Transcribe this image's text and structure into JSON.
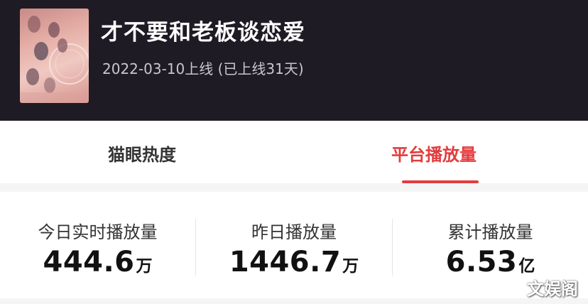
{
  "header": {
    "title": "才不要和老板谈恋爱",
    "release_info": "2022-03-10上线 (已上线31天)"
  },
  "tabs": [
    {
      "label": "猫眼热度",
      "active": false
    },
    {
      "label": "平台播放量",
      "active": true
    }
  ],
  "stats": [
    {
      "label": "今日实时播放量",
      "value": "444.6",
      "unit": "万"
    },
    {
      "label": "昨日播放量",
      "value": "1446.7",
      "unit": "万"
    },
    {
      "label": "累计播放量",
      "value": "6.53",
      "unit": "亿"
    }
  ],
  "watermark": "文娱阁",
  "colors": {
    "header_bg": "#1f1b24",
    "accent": "#e43b3d",
    "page_bg": "#f5f5f5"
  }
}
